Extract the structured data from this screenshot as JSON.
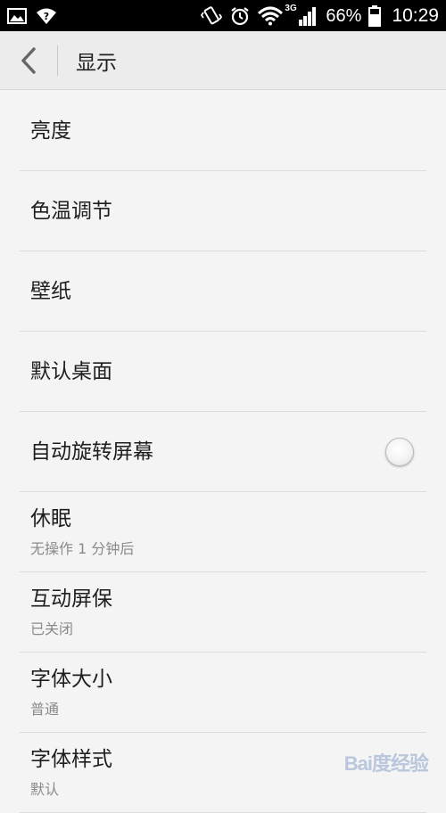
{
  "status_bar": {
    "network_type": "3G",
    "battery": "66%",
    "time": "10:29",
    "icons": [
      "image-icon",
      "wifi-question-icon",
      "vibrate-icon",
      "alarm-icon",
      "wifi-icon",
      "signal-icon",
      "battery-icon"
    ]
  },
  "header": {
    "title": "显示",
    "back_icon": "back-arrow-icon"
  },
  "settings": [
    {
      "label": "亮度",
      "sub": ""
    },
    {
      "label": "色温调节",
      "sub": ""
    },
    {
      "label": "壁纸",
      "sub": ""
    },
    {
      "label": "默认桌面",
      "sub": ""
    },
    {
      "label": "自动旋转屏幕",
      "sub": "",
      "toggle": "off"
    },
    {
      "label": "休眠",
      "sub": "无操作 1 分钟后"
    },
    {
      "label": "互动屏保",
      "sub": "已关闭"
    },
    {
      "label": "字体大小",
      "sub": "普通"
    },
    {
      "label": "字体样式",
      "sub": "默认"
    }
  ],
  "watermark": {
    "text": "Bai度经验"
  }
}
